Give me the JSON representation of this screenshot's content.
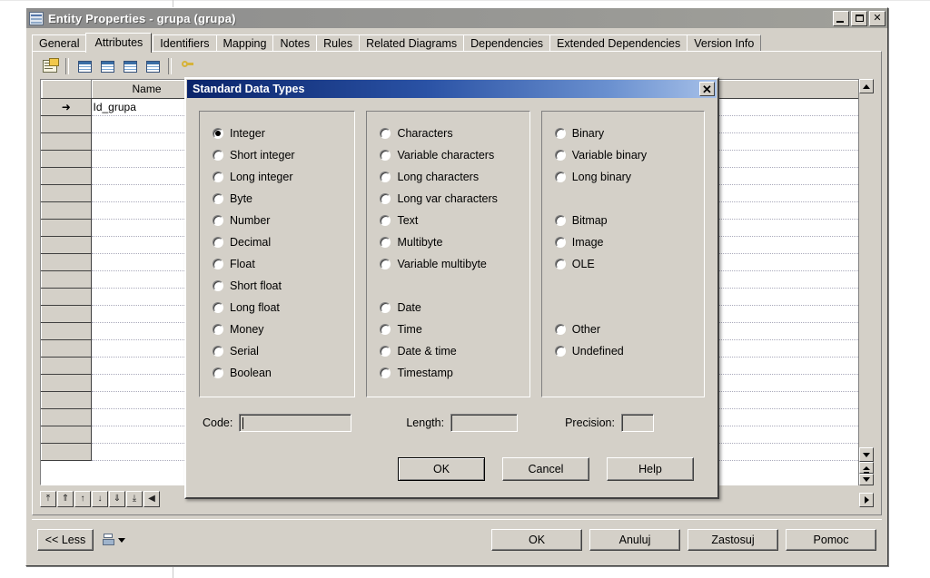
{
  "window": {
    "title": "Entity Properties - grupa (grupa)",
    "icon": "table-icon",
    "minimize_label": "_",
    "maximize_label": "□",
    "close_label": "✕"
  },
  "tabs": [
    {
      "label": "General",
      "active": false
    },
    {
      "label": "Attributes",
      "active": true
    },
    {
      "label": "Identifiers",
      "active": false
    },
    {
      "label": "Mapping",
      "active": false
    },
    {
      "label": "Notes",
      "active": false
    },
    {
      "label": "Rules",
      "active": false
    },
    {
      "label": "Related Diagrams",
      "active": false
    },
    {
      "label": "Dependencies",
      "active": false
    },
    {
      "label": "Extended Dependencies",
      "active": false
    },
    {
      "label": "Version Info",
      "active": false
    }
  ],
  "toolbar": {
    "items": [
      {
        "name": "properties-icon"
      },
      {
        "name": "insert-row-icon"
      },
      {
        "name": "add-table-icon"
      },
      {
        "name": "add-column-icon"
      },
      {
        "name": "reuse-column-icon"
      },
      {
        "name": "key-icon"
      }
    ]
  },
  "grid": {
    "columns": [
      "",
      "Name",
      "",
      ""
    ],
    "name_header": "Name",
    "row_indicator": "➜",
    "rows": [
      {
        "indicator": "➜",
        "name": "Id_grupa"
      },
      {
        "indicator": "",
        "name": ""
      },
      {
        "indicator": "",
        "name": ""
      },
      {
        "indicator": "",
        "name": ""
      },
      {
        "indicator": "",
        "name": ""
      },
      {
        "indicator": "",
        "name": ""
      },
      {
        "indicator": "",
        "name": ""
      },
      {
        "indicator": "",
        "name": ""
      },
      {
        "indicator": "",
        "name": ""
      },
      {
        "indicator": "",
        "name": ""
      },
      {
        "indicator": "",
        "name": ""
      },
      {
        "indicator": "",
        "name": ""
      },
      {
        "indicator": "",
        "name": ""
      },
      {
        "indicator": "",
        "name": ""
      },
      {
        "indicator": "",
        "name": ""
      },
      {
        "indicator": "",
        "name": ""
      },
      {
        "indicator": "",
        "name": ""
      },
      {
        "indicator": "",
        "name": ""
      },
      {
        "indicator": "",
        "name": ""
      },
      {
        "indicator": "",
        "name": ""
      },
      {
        "indicator": "",
        "name": ""
      }
    ]
  },
  "grid_nav": [
    {
      "name": "first-record-button",
      "glyph": "⤒"
    },
    {
      "name": "page-up-button",
      "glyph": "⇑"
    },
    {
      "name": "previous-record-button",
      "glyph": "↑"
    },
    {
      "name": "next-record-button",
      "glyph": "↓"
    },
    {
      "name": "page-down-button",
      "glyph": "⇓"
    },
    {
      "name": "last-record-button",
      "glyph": "⤓"
    },
    {
      "name": "scroll-left-button",
      "glyph": "◀"
    }
  ],
  "bottom_bar": {
    "less_label": "<< Less",
    "print_icon": "print-icon",
    "buttons": [
      {
        "name": "ok-button",
        "label": "OK"
      },
      {
        "name": "cancel-button",
        "label": "Anuluj"
      },
      {
        "name": "apply-button",
        "label": "Zastosuj"
      },
      {
        "name": "help-button",
        "label": "Pomoc"
      }
    ]
  },
  "dialog": {
    "title": "Standard Data Types",
    "close_label": "✕",
    "selected": "Integer",
    "columns": [
      {
        "name": "numeric-types-group",
        "options": [
          {
            "label": "Integer",
            "checked": true
          },
          {
            "label": "Short integer",
            "checked": false
          },
          {
            "label": "Long integer",
            "checked": false
          },
          {
            "label": "Byte",
            "checked": false
          },
          {
            "label": "Number",
            "checked": false
          },
          {
            "label": "Decimal",
            "checked": false
          },
          {
            "label": "Float",
            "checked": false
          },
          {
            "label": "Short float",
            "checked": false
          },
          {
            "label": "Long float",
            "checked": false
          },
          {
            "label": "Money",
            "checked": false
          },
          {
            "label": "Serial",
            "checked": false
          },
          {
            "label": "Boolean",
            "checked": false
          }
        ]
      },
      {
        "name": "character-types-group",
        "options": [
          {
            "label": "Characters",
            "checked": false
          },
          {
            "label": "Variable characters",
            "checked": false
          },
          {
            "label": "Long characters",
            "checked": false
          },
          {
            "label": "Long var characters",
            "checked": false
          },
          {
            "label": "Text",
            "checked": false
          },
          {
            "label": "Multibyte",
            "checked": false
          },
          {
            "label": "Variable multibyte",
            "checked": false
          },
          {
            "label": "",
            "checked": false,
            "spacer": true
          },
          {
            "label": "Date",
            "checked": false
          },
          {
            "label": "Time",
            "checked": false
          },
          {
            "label": "Date & time",
            "checked": false
          },
          {
            "label": "Timestamp",
            "checked": false
          }
        ]
      },
      {
        "name": "binary-other-types-group",
        "options": [
          {
            "label": "Binary",
            "checked": false
          },
          {
            "label": "Variable binary",
            "checked": false
          },
          {
            "label": "Long binary",
            "checked": false
          },
          {
            "label": "",
            "checked": false,
            "spacer": true
          },
          {
            "label": "Bitmap",
            "checked": false
          },
          {
            "label": "Image",
            "checked": false
          },
          {
            "label": "OLE",
            "checked": false
          },
          {
            "label": "",
            "checked": false,
            "spacer": true
          },
          {
            "label": "",
            "checked": false,
            "spacer": true
          },
          {
            "label": "Other",
            "checked": false
          },
          {
            "label": "Undefined",
            "checked": false
          }
        ]
      }
    ],
    "fields": {
      "code_label": "Code:",
      "code_value": "",
      "length_label": "Length:",
      "length_value": "",
      "precision_label": "Precision:",
      "precision_value": ""
    },
    "buttons": [
      {
        "name": "dialog-ok-button",
        "label": "OK",
        "default": true
      },
      {
        "name": "dialog-cancel-button",
        "label": "Cancel",
        "default": false
      },
      {
        "name": "dialog-help-button",
        "label": "Help",
        "default": false
      }
    ]
  }
}
